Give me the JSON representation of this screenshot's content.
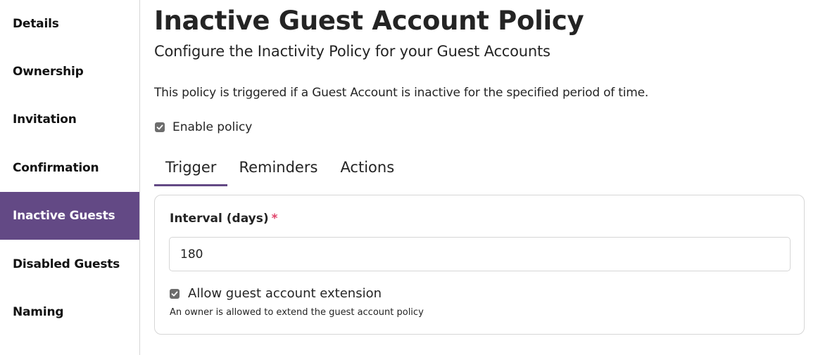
{
  "sidebar": {
    "items": [
      {
        "label": "Details",
        "active": false
      },
      {
        "label": "Ownership",
        "active": false
      },
      {
        "label": "Invitation",
        "active": false
      },
      {
        "label": "Confirmation",
        "active": false
      },
      {
        "label": "Inactive Guests",
        "active": true
      },
      {
        "label": "Disabled Guests",
        "active": false
      },
      {
        "label": "Naming",
        "active": false
      }
    ]
  },
  "header": {
    "title": "Inactive Guest Account Policy",
    "subtitle": "Configure the Inactivity Policy for your Guest Accounts"
  },
  "main": {
    "description": "This policy is triggered if a Guest Account is inactive for the specified period of time.",
    "enable_policy": {
      "label": "Enable policy",
      "checked": true
    },
    "tabs": [
      {
        "label": "Trigger",
        "active": true
      },
      {
        "label": "Reminders",
        "active": false
      },
      {
        "label": "Actions",
        "active": false
      }
    ],
    "trigger": {
      "interval_label": "Interval (days)",
      "required_mark": "*",
      "interval_value": "180",
      "allow_extension": {
        "label": "Allow guest account extension",
        "checked": true
      },
      "help_text": "An owner is allowed to extend the guest account policy"
    }
  },
  "colors": {
    "accent": "#634985",
    "required": "#e0436a",
    "border": "#d6d6d6",
    "checkbox": "#6d6d6d"
  }
}
